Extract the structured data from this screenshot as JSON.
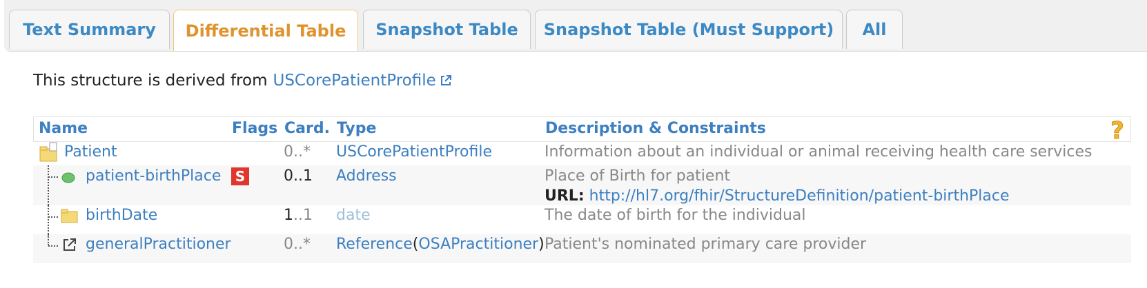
{
  "tabs": [
    {
      "label": "Text Summary",
      "active": false
    },
    {
      "label": "Differential Table",
      "active": true
    },
    {
      "label": "Snapshot Table",
      "active": false
    },
    {
      "label": "Snapshot Table (Must Support)",
      "active": false
    },
    {
      "label": "All",
      "active": false
    }
  ],
  "intro": {
    "text": "This structure is derived from",
    "link": "USCorePatientProfile",
    "link_icon": "external-link-icon"
  },
  "table": {
    "headers": {
      "name": "Name",
      "flags": "Flags",
      "card": "Card.",
      "type": "Type",
      "desc": "Description & Constraints",
      "help_icon": "question-mark-icon"
    },
    "rows": [
      {
        "icon": "folder-icon",
        "name": "Patient",
        "flag": "",
        "card_min": "0",
        "card_max": "*",
        "type": "USCorePatientProfile",
        "desc": "Information about an individual or animal receiving health care services"
      },
      {
        "icon": "extension-icon",
        "name": "patient-birthPlace",
        "flag": "S",
        "card_min": "0",
        "card_max": "1",
        "type": "Address",
        "desc": "Place of Birth for patient",
        "url_label": "URL:",
        "url": "http://hl7.org/fhir/StructureDefinition/patient-birthPlace"
      },
      {
        "icon": "folder-icon",
        "name": "birthDate",
        "flag": "",
        "card_min": "1",
        "card_max": "1",
        "type": "date",
        "desc": "The date of birth for the individual"
      },
      {
        "icon": "reference-icon",
        "name": "generalPractitioner",
        "flag": "",
        "card_min": "0",
        "card_max": "*",
        "type": "Reference",
        "type_target": "OSAPractitioner",
        "desc": "Patient's nominated primary care provider"
      }
    ]
  },
  "colors": {
    "link": "#3d7fc0",
    "tab_active": "#e0922d",
    "flag_red": "#e0362d",
    "muted": "#888888"
  }
}
